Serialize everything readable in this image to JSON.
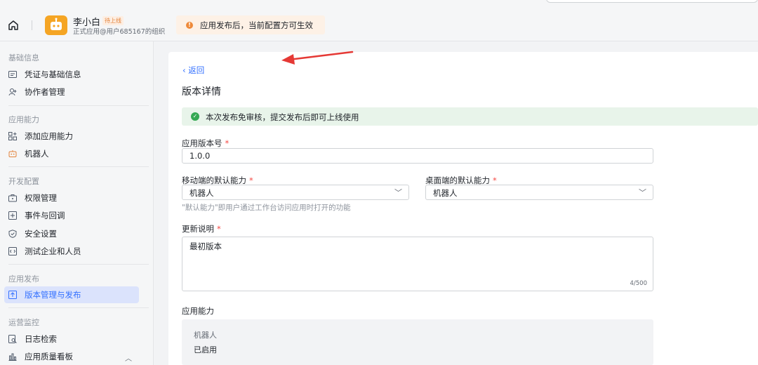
{
  "header": {
    "app_name": "李小白",
    "app_status_badge": "待上线",
    "app_subtitle": "正式应用@用户685167的组织",
    "notice_text": "应用发布后，当前配置方可生效"
  },
  "sidebar": {
    "sections": [
      {
        "title": "基础信息",
        "items": [
          {
            "label": "凭证与基础信息",
            "icon": "credential-icon"
          },
          {
            "label": "协作者管理",
            "icon": "collaborator-icon"
          }
        ]
      },
      {
        "title": "应用能力",
        "items": [
          {
            "label": "添加应用能力",
            "icon": "add-capability-icon"
          },
          {
            "label": "机器人",
            "icon": "robot-icon"
          }
        ]
      },
      {
        "title": "开发配置",
        "items": [
          {
            "label": "权限管理",
            "icon": "permission-icon"
          },
          {
            "label": "事件与回调",
            "icon": "event-icon"
          },
          {
            "label": "安全设置",
            "icon": "shield-icon"
          },
          {
            "label": "测试企业和人员",
            "icon": "test-icon"
          }
        ]
      },
      {
        "title": "应用发布",
        "items": [
          {
            "label": "版本管理与发布",
            "icon": "upload-icon",
            "active": true
          }
        ]
      },
      {
        "title": "运营监控",
        "items": [
          {
            "label": "日志检索",
            "icon": "log-search-icon"
          },
          {
            "label": "应用质量看板",
            "icon": "chart-icon"
          }
        ]
      }
    ]
  },
  "main": {
    "back_label": "返回",
    "page_title": "版本详情",
    "success_message": "本次发布免审核，提交发布后即可上线使用",
    "version": {
      "label": "应用版本号",
      "required_mark": "*",
      "value": "1.0.0"
    },
    "mobile_default": {
      "label": "移动端的默认能力",
      "required_mark": "*",
      "value": "机器人"
    },
    "desktop_default": {
      "label": "桌面端的默认能力",
      "required_mark": "*",
      "value": "机器人"
    },
    "default_hint": "\"默认能力\"即用户通过工作台访问应用时打开的功能",
    "release_notes": {
      "label": "更新说明",
      "required_mark": "*",
      "value": "最初版本",
      "counter": "4/500"
    },
    "capabilities": {
      "label": "应用能力",
      "name": "机器人",
      "status": "已启用"
    }
  },
  "colors": {
    "accent": "#3370ff",
    "active_bg": "#dbe3fc",
    "success_bg": "#e8f4ea",
    "notice_bg": "#fdf1e6",
    "annotation_arrow": "#e53935"
  }
}
